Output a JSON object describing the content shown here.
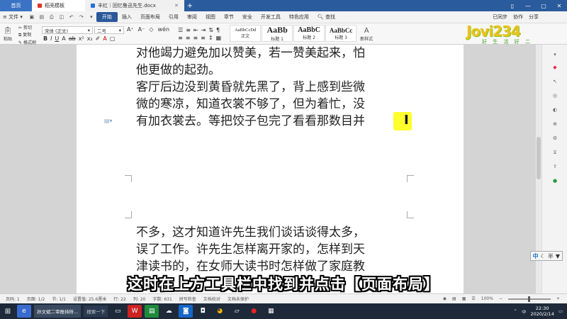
{
  "tabs": {
    "home": "首页",
    "templates": "稻壳模板",
    "doc": "丰红｜回忆鲁迅先生.docx"
  },
  "window_controls": [
    "▯",
    "—",
    "▢",
    "✕"
  ],
  "menubar": {
    "file": "文件",
    "items": [
      "开始",
      "插入",
      "页面布局",
      "引用",
      "审阅",
      "视图",
      "章节",
      "安全",
      "开发工具",
      "特色应用"
    ],
    "active": "开始",
    "search": "查找",
    "right": [
      "已同步",
      "协作",
      "分享"
    ]
  },
  "ribbon": {
    "paste": "粘贴",
    "cut": "剪切",
    "copy": "复制",
    "format_painter": "格式刷",
    "font_name": "宋体 (正文)",
    "font_size": "二号",
    "styles": [
      {
        "preview": "AaBbCcDd",
        "name": "正文"
      },
      {
        "preview": "AaBb",
        "name": "标题 1"
      },
      {
        "preview": "AaBbC",
        "name": "标题 2"
      },
      {
        "preview": "AaBbCc",
        "name": "标题 3"
      }
    ],
    "new_style": "新样式",
    "text_tools": "文字工具",
    "find_replace": "查找替换",
    "select": "选择"
  },
  "watermark": {
    "brand": "Jovi234",
    "slogan": "好 生 活 好 二"
  },
  "document": {
    "page1_lines": [
      "对他竭力避免加以赞美，若一赞美起来，怕",
      "他更做的起劲。",
      "客厅后边没到黄昏就先黑了，背上感到些微",
      "微的寒凉，知道衣裳不够了，但为着忙，没",
      "有加衣裳去。等把饺子包完了看看那数目并"
    ],
    "page2_lines": [
      "不多，这才知道许先生我们谈话谈得太多，",
      "误了工作。许先生怎样离开家的，怎样到天",
      "津读书的，在女师大读书时怎样做了家庭教"
    ]
  },
  "subtitle": "这时在上方工具栏中找到并点击【页面布局】",
  "statusbar": {
    "page_num": "页码: 1",
    "page": "页面: 1/2",
    "section": "节: 1/1",
    "setting": "设置值: 25.6厘米",
    "row": "行: 22",
    "col": "列: 20",
    "words": "字数: 631",
    "spell": "拼写检查",
    "proof": "文档校对",
    "protect": "文档未保护",
    "zoom": "100%"
  },
  "ime": {
    "lang": "中",
    "mode": "半"
  },
  "taskbar": {
    "task1": "孙文斌二审推持所...",
    "search": "搜索一下",
    "time": "22:30",
    "date": "2020/2/14"
  },
  "colors": {
    "tab_strip": "#2a5b9c",
    "active_menu": "#2b579a",
    "highlight": "#ffff2d",
    "taskbar": "#1e2a3a"
  }
}
